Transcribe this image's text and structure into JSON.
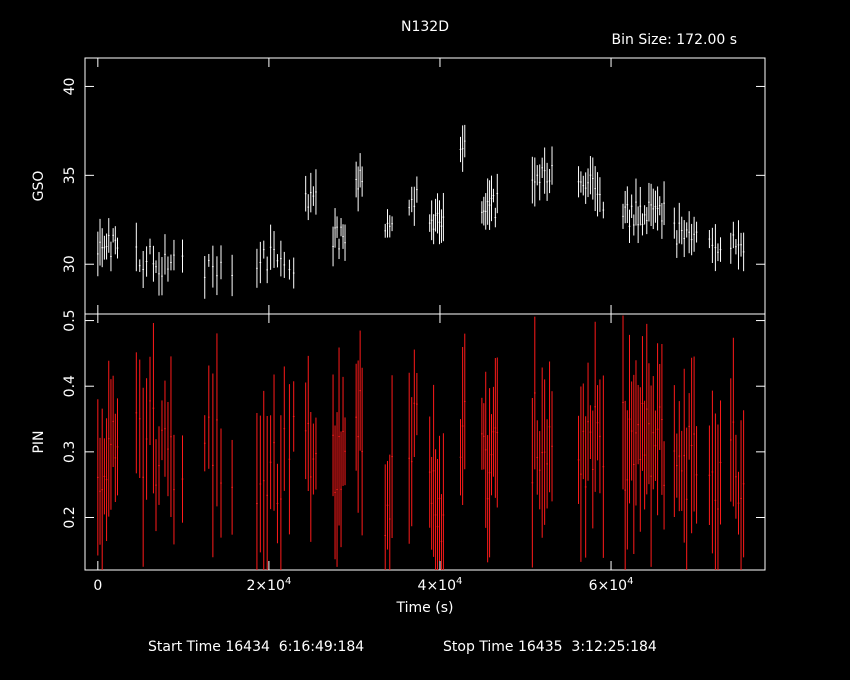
{
  "chart_data": {
    "type": "line",
    "title": "N132D",
    "bin_size_label": "Bin Size: 172.00 s",
    "xlabel": "Time (s)",
    "xlim": [
      -1500,
      78000
    ],
    "x_ticks": [
      {
        "value": 0,
        "label": "0"
      },
      {
        "value": 20000,
        "label": "2×10",
        "exp": "4"
      },
      {
        "value": 40000,
        "label": "4×10",
        "exp": "4"
      },
      {
        "value": 60000,
        "label": "6×10",
        "exp": "4"
      }
    ],
    "footer": {
      "start_label": "Start Time 16434  6:16:49:184",
      "stop_label": "Stop Time 16435  3:12:25:184"
    },
    "panels": [
      {
        "name": "GSO",
        "ylabel": "GSO",
        "color": "#ffffff",
        "ylim": [
          27.2,
          41.6
        ],
        "y_ticks": [
          30,
          35,
          40
        ],
        "segments": [
          [
            0,
            10,
            2300,
            31.1
          ],
          [
            4500,
            6,
            2000,
            30.3
          ],
          [
            6800,
            7,
            2100,
            29.9
          ],
          [
            9900,
            1,
            0,
            30.5
          ],
          [
            12500,
            5,
            1900,
            29.6
          ],
          [
            15700,
            1,
            0,
            29.3
          ],
          [
            18600,
            9,
            3200,
            30.3
          ],
          [
            22400,
            2,
            500,
            29.5
          ],
          [
            24300,
            5,
            1200,
            33.9
          ],
          [
            27500,
            7,
            1400,
            31.5
          ],
          [
            30200,
            4,
            700,
            34.9
          ],
          [
            33600,
            4,
            800,
            32.1
          ],
          [
            36400,
            4,
            900,
            33.8
          ],
          [
            38800,
            8,
            1600,
            32.5
          ],
          [
            42400,
            3,
            500,
            36.6
          ],
          [
            44900,
            9,
            1800,
            33.3
          ],
          [
            50800,
            9,
            2300,
            34.9
          ],
          [
            56200,
            10,
            2500,
            34.5
          ],
          [
            59100,
            1,
            0,
            33.4
          ],
          [
            61400,
            20,
            4800,
            32.8
          ],
          [
            67400,
            10,
            2600,
            31.8
          ],
          [
            71500,
            3,
            700,
            31.2
          ],
          [
            72500,
            2,
            300,
            30.4
          ],
          [
            74000,
            6,
            1500,
            31.0
          ]
        ],
        "errors": [
          0.35,
          1.4
        ],
        "spread": 0.7
      },
      {
        "name": "PIN",
        "ylabel": "PIN",
        "color": "#ff1a1a",
        "ylim": [
          0.12,
          0.51
        ],
        "y_ticks": [
          0.2,
          0.3,
          0.4,
          0.5
        ],
        "segments": [
          [
            0,
            10,
            2300,
            0.29
          ],
          [
            4500,
            6,
            2000,
            0.31
          ],
          [
            6800,
            7,
            2100,
            0.29
          ],
          [
            9900,
            1,
            0,
            0.28
          ],
          [
            12500,
            5,
            1900,
            0.3
          ],
          [
            15700,
            1,
            0,
            0.22
          ],
          [
            18600,
            9,
            3200,
            0.29
          ],
          [
            22400,
            2,
            500,
            0.3
          ],
          [
            24300,
            5,
            1200,
            0.33
          ],
          [
            27500,
            7,
            1400,
            0.3
          ],
          [
            30200,
            4,
            700,
            0.33
          ],
          [
            33600,
            4,
            800,
            0.24
          ],
          [
            36400,
            4,
            900,
            0.32
          ],
          [
            38800,
            8,
            1600,
            0.23
          ],
          [
            42400,
            3,
            500,
            0.33
          ],
          [
            44900,
            9,
            1800,
            0.28
          ],
          [
            50800,
            9,
            2300,
            0.32
          ],
          [
            56200,
            10,
            2500,
            0.3
          ],
          [
            59100,
            1,
            0,
            0.28
          ],
          [
            61400,
            20,
            4800,
            0.31
          ],
          [
            67400,
            10,
            2600,
            0.29
          ],
          [
            71500,
            3,
            700,
            0.28
          ],
          [
            72500,
            2,
            300,
            0.25
          ],
          [
            74000,
            6,
            1500,
            0.28
          ]
        ],
        "errors": [
          0.04,
          0.14
        ],
        "spread": 0.07
      }
    ]
  }
}
